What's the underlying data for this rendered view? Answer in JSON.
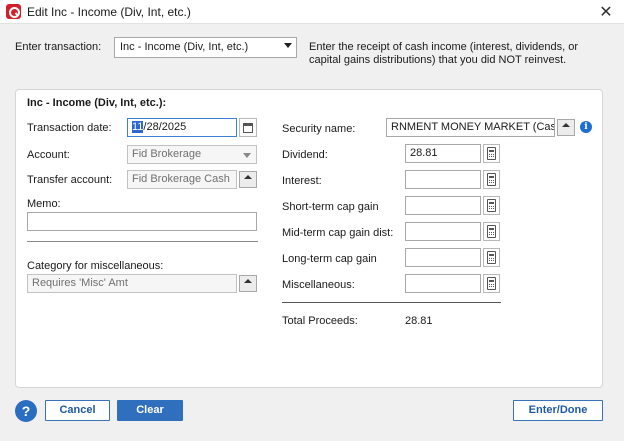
{
  "window": {
    "title": "Edit Inc - Income (Div, Int, etc.)",
    "close_glyph": "✕"
  },
  "header": {
    "enter_transaction_label": "Enter transaction:",
    "transaction_type": "Inc - Income (Div, Int, etc.)",
    "description": "Enter the receipt of cash income (interest, dividends, or capital gains distributions) that you did NOT reinvest."
  },
  "panel": {
    "title": "Inc - Income (Div, Int, etc.):",
    "left": {
      "transaction_date_label": "Transaction date:",
      "transaction_date_selected": "11",
      "transaction_date_rest": "/28/2025",
      "account_label": "Account:",
      "account_value": "Fid Brokerage",
      "transfer_account_label": "Transfer account:",
      "transfer_account_value": "Fid Brokerage Cash",
      "memo_label": "Memo:",
      "memo_value": "",
      "category_label": "Category for miscellaneous:",
      "category_placeholder": "Requires 'Misc' Amt"
    },
    "right": {
      "security_name_label": "Security name:",
      "security_name_value": "RNMENT MONEY MARKET (Cash)",
      "dividend_label": "Dividend:",
      "dividend_value": "28.81",
      "interest_label": "Interest:",
      "interest_value": "",
      "short_term_label": "Short-term cap gain",
      "short_term_value": "",
      "mid_term_label": "Mid-term cap gain dist:",
      "mid_term_value": "",
      "long_term_label": "Long-term cap gain",
      "long_term_value": "",
      "misc_label": "Miscellaneous:",
      "misc_value": "",
      "total_label": "Total Proceeds:",
      "total_value": "28.81"
    }
  },
  "footer": {
    "help_glyph": "?",
    "cancel_label": "Cancel",
    "clear_label": "Clear",
    "enter_done_label": "Enter/Done"
  },
  "icons": {
    "info_glyph": "i"
  },
  "colors": {
    "accent": "#2f6fbe",
    "brand": "#d0202a"
  }
}
